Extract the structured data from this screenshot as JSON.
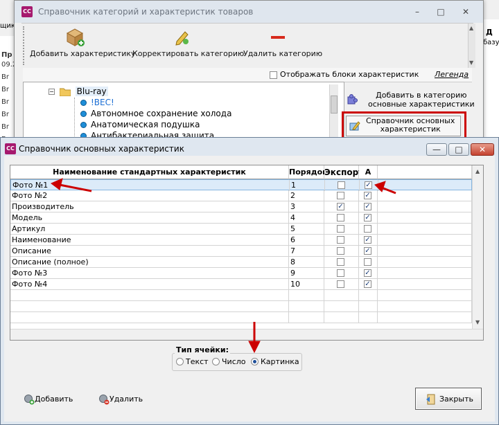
{
  "bg": {
    "left_header": "щик",
    "left_header2": "Пр",
    "left_date": "09.2",
    "left_rows": [
      "Br",
      "Br",
      "Br",
      "Br",
      "Br",
      "Br",
      "Br",
      "Br"
    ],
    "right_header": "Д",
    "right_text": "базу з"
  },
  "win1": {
    "icon_text": "СС",
    "title": "Справочник категорий и характеристик товаров",
    "buttons": {
      "minimize": "–",
      "maximize": "□",
      "close": "✕"
    },
    "toolbar": {
      "add_char": "Добавить характеристику",
      "edit_cat": "Корректировать категорию",
      "delete_cat": "Удалить категорию"
    },
    "show_blocks_label": "Отображать блоки характеристик",
    "legend_link": "Легенда",
    "tree": {
      "root": "Blu-ray",
      "items": [
        "!ВЕС!",
        "Автономное сохранение холода",
        "Анатомическая подушка",
        "Антибактериальная защита"
      ]
    },
    "add_to_cat": "Добавить в категорию\nосновные характеристики",
    "main_chars_button": "Справочник основных\nхарактеристик"
  },
  "dialog": {
    "icon_text": "СС",
    "title": "Справочник основных характеристик",
    "buttons": {
      "minimize": "—",
      "maximize": "□",
      "close": "✕"
    },
    "columns": [
      "Наименование стандартных характеристик",
      "Порядок",
      "Экспорт",
      "А"
    ],
    "rows": [
      {
        "name": "Фото №1",
        "order": "1",
        "export": false,
        "a": true
      },
      {
        "name": "Фото №2",
        "order": "2",
        "export": false,
        "a": true
      },
      {
        "name": "Производитель",
        "order": "3",
        "export": true,
        "a": true
      },
      {
        "name": "Модель",
        "order": "4",
        "export": false,
        "a": true
      },
      {
        "name": "Артикул",
        "order": "5",
        "export": false,
        "a": false
      },
      {
        "name": "Наименование",
        "order": "6",
        "export": false,
        "a": true
      },
      {
        "name": "Описание",
        "order": "7",
        "export": false,
        "a": true
      },
      {
        "name": "Описание (полное)",
        "order": "8",
        "export": false,
        "a": false
      },
      {
        "name": "Фото №3",
        "order": "9",
        "export": false,
        "a": true
      },
      {
        "name": "Фото №4",
        "order": "10",
        "export": false,
        "a": true
      }
    ],
    "cell_type": {
      "label": "Тип ячейки:",
      "options": [
        "Текст",
        "Число",
        "Картинка"
      ],
      "selected": "Картинка"
    },
    "add_button": "Добавить",
    "delete_button": "Удалить",
    "close_button": "Закрыть"
  },
  "colors": {
    "annotation_red": "#cc0000",
    "selection": "#dcebf9",
    "app_icon": "#a6196e"
  }
}
